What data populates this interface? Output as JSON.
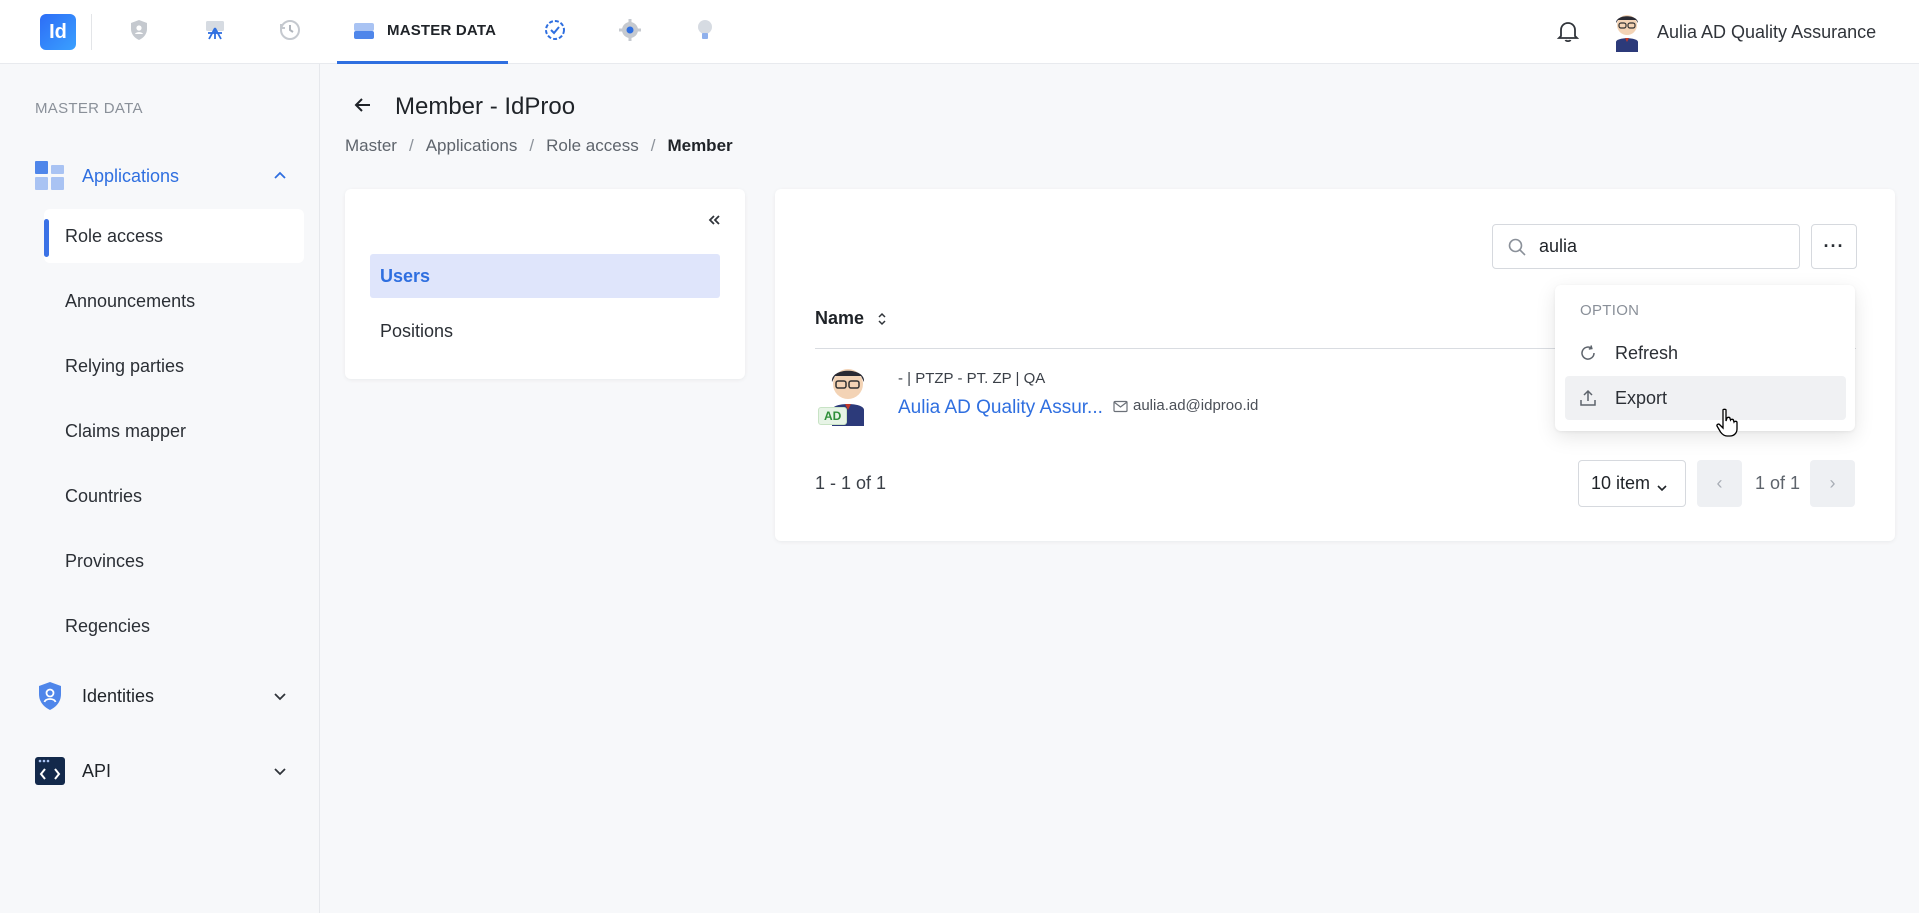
{
  "topbar": {
    "logo_text": "Id",
    "active_tab_label": "MASTER DATA",
    "nav_icons": [
      "shield-icon",
      "broadcast-icon",
      "history-icon",
      "database-icon",
      "verified-badge-icon",
      "settings-icon",
      "lightbulb-icon"
    ],
    "user_name": "Aulia AD Quality Assurance"
  },
  "sidebar": {
    "heading": "MASTER DATA",
    "groups": [
      {
        "label": "Applications",
        "expanded": true,
        "items": [
          "Role access",
          "Announcements",
          "Relying parties",
          "Claims mapper",
          "Countries",
          "Provinces",
          "Regencies"
        ],
        "active_item": "Role access"
      },
      {
        "label": "Identities",
        "expanded": false
      },
      {
        "label": "API",
        "expanded": false
      }
    ]
  },
  "page": {
    "title": "Member - IdProo",
    "breadcrumb": [
      "Master",
      "Applications",
      "Role access",
      "Member"
    ]
  },
  "left_panel": {
    "items": [
      "Users",
      "Positions"
    ],
    "active": "Users"
  },
  "table": {
    "search_value": "aulia",
    "columns": [
      "Name"
    ],
    "rows": [
      {
        "meta": "- | PTZP - PT. ZP | QA",
        "name": "Aulia AD Quality Assur...",
        "email": "aulia.ad@idproo.id",
        "badge": "AD"
      }
    ],
    "range_text": "1 - 1 of 1",
    "per_page": "10 item",
    "page_text": "1 of 1"
  },
  "dropdown": {
    "title": "OPTION",
    "items": [
      "Refresh",
      "Export"
    ],
    "hovered": "Export"
  },
  "colors": {
    "accent": "#2f6fe0",
    "active_bg": "#dfe5fb",
    "badge_green": "#2f8f3a"
  }
}
